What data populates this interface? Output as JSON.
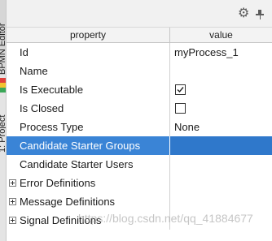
{
  "side_tabs": {
    "bpmn_editor": "BPMN Editor",
    "project": "1: Project"
  },
  "table": {
    "columns": [
      "property",
      "value"
    ],
    "rows": [
      {
        "property": "Id",
        "value": "myProcess_1",
        "kind": "text"
      },
      {
        "property": "Name",
        "value": "",
        "kind": "text"
      },
      {
        "property": "Is Executable",
        "value": "",
        "kind": "checkbox",
        "checked": true
      },
      {
        "property": "Is Closed",
        "value": "",
        "kind": "checkbox",
        "checked": false
      },
      {
        "property": "Process Type",
        "value": "None",
        "kind": "text"
      },
      {
        "property": "Candidate Starter Groups",
        "value": "",
        "kind": "text",
        "selected": true
      },
      {
        "property": "Candidate Starter Users",
        "value": "",
        "kind": "text"
      },
      {
        "property": "Error Definitions",
        "kind": "group",
        "collapsed": true
      },
      {
        "property": "Message Definitions",
        "kind": "group",
        "collapsed": true
      },
      {
        "property": "Signal Definitions",
        "kind": "group",
        "collapsed": true
      }
    ]
  },
  "toolbar": {
    "settings_icon": "gear-icon",
    "pin_icon": "pin-icon"
  },
  "watermark": "https://blog.csdn.net/qq_41884677",
  "colors": {
    "selection": "#3a84d6",
    "header_bg": "#f3f3f3",
    "toolbar_bg": "#f1f1f1"
  }
}
